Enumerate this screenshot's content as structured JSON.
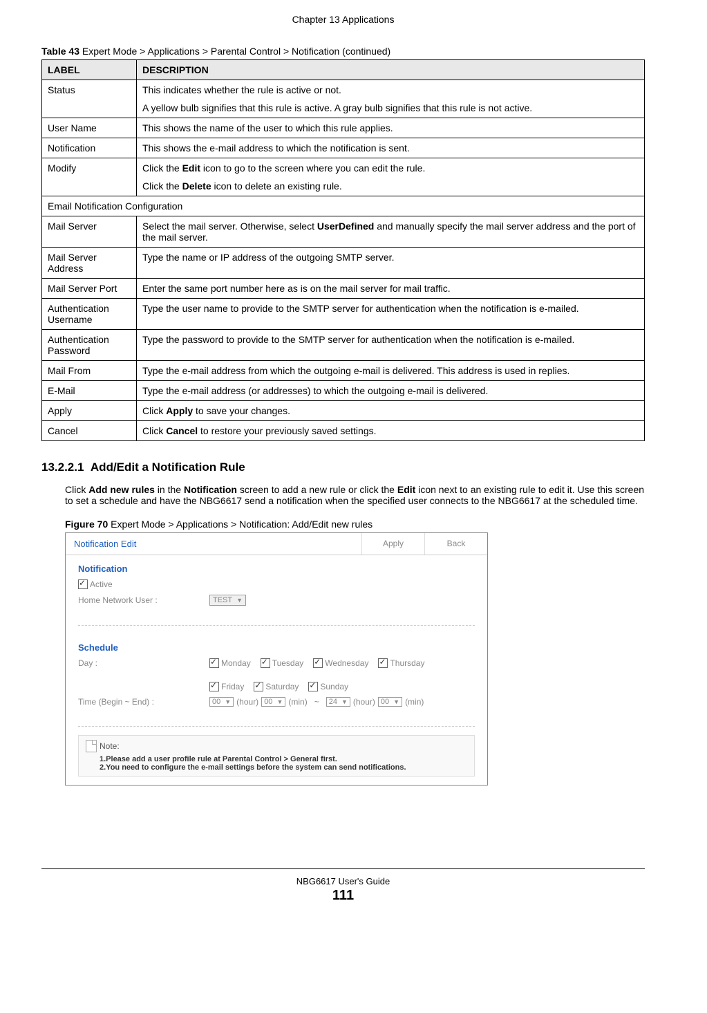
{
  "chapter_header": "Chapter 13 Applications",
  "table_caption_bold": "Table 43",
  "table_caption_rest": "   Expert Mode > Applications > Parental Control > Notification  (continued)",
  "table_headers": {
    "label": "LABEL",
    "description": "DESCRIPTION"
  },
  "rows": [
    {
      "label": "Status",
      "desc_p1": "This indicates whether the rule is active or not.",
      "desc_p2": "A yellow bulb signifies that this rule is active. A gray bulb signifies that this rule is not active."
    },
    {
      "label": "User Name",
      "desc_p1": "This shows the name of the user to which this rule applies."
    },
    {
      "label": "Notification",
      "desc_p1": "This shows the e-mail address to which the notification is sent."
    },
    {
      "label": "Modify",
      "desc_p1_pre": "Click the ",
      "desc_p1_bold": "Edit",
      "desc_p1_post": " icon to go to the screen where you can edit the rule.",
      "desc_p2_pre": "Click the ",
      "desc_p2_bold": "Delete",
      "desc_p2_post": " icon to delete an existing rule."
    }
  ],
  "row_span": "Email Notification Configuration",
  "rows2": [
    {
      "label": "Mail Server",
      "desc_pre": "Select the mail server. Otherwise, select ",
      "desc_bold": "UserDefined",
      "desc_post": " and manually specify the mail server address and the port of the mail server."
    },
    {
      "label": "Mail Server Address",
      "desc": "Type the name or IP address of the outgoing SMTP server."
    },
    {
      "label": "Mail Server Port",
      "desc": "Enter the same port number here as is on the mail server for mail traffic."
    },
    {
      "label": "Authentication Username",
      "desc": "Type the user name to provide to the SMTP server for authentication when the notification is e-mailed."
    },
    {
      "label": "Authentication Password",
      "desc": "Type the password to provide to the SMTP server for authentication when the notification is e-mailed."
    },
    {
      "label": "Mail From",
      "desc": "Type the e-mail address from which the outgoing e-mail is delivered. This address is used in replies."
    },
    {
      "label": "E-Mail",
      "desc": "Type the e-mail address (or addresses) to which the outgoing e-mail is delivered."
    },
    {
      "label": "Apply",
      "desc_pre": "Click ",
      "desc_bold": "Apply",
      "desc_post": " to save your changes."
    },
    {
      "label": "Cancel",
      "desc_pre": "Click ",
      "desc_bold": "Cancel",
      "desc_post": " to restore your previously saved settings."
    }
  ],
  "section_number": "13.2.2.1",
  "section_title": "Add/Edit a Notification Rule",
  "body_p_pre": "Click ",
  "body_b1": "Add new rules",
  "body_mid1": " in the ",
  "body_b2": "Notification",
  "body_mid2": " screen to add a new rule or click the ",
  "body_b3": "Edit",
  "body_post": " icon next to an existing rule to edit it. Use this screen to set a schedule and have the NBG6617 send a notification when the specified user connects to the NBG6617 at the scheduled time.",
  "figure_caption_bold": "Figure 70",
  "figure_caption_rest": "   Expert Mode > Applications > Notification: Add/Edit new rules",
  "ui": {
    "header_title": "Notification Edit",
    "apply_btn": "Apply",
    "back_btn": "Back",
    "notification_title": "Notification",
    "active_label": "Active",
    "home_user_label": "Home Network User :",
    "home_user_value": "TEST",
    "schedule_title": "Schedule",
    "day_label": "Day :",
    "days": [
      "Monday",
      "Tuesday",
      "Wednesday",
      "Thursday",
      "Friday",
      "Saturday",
      "Sunday"
    ],
    "time_label": "Time (Begin ~ End) :",
    "hour1": "00",
    "hour_txt": "(hour)",
    "min1": "00",
    "min_txt": "(min)",
    "tilde": "~",
    "hour2": "24",
    "min2": "00",
    "note_label": "Note:",
    "note1": "1.Please add a user profile rule at Parental Control > General first.",
    "note2": "2.You need to configure the e-mail settings before the system can send notifications."
  },
  "footer_guide": "NBG6617 User's Guide",
  "footer_page": "111"
}
